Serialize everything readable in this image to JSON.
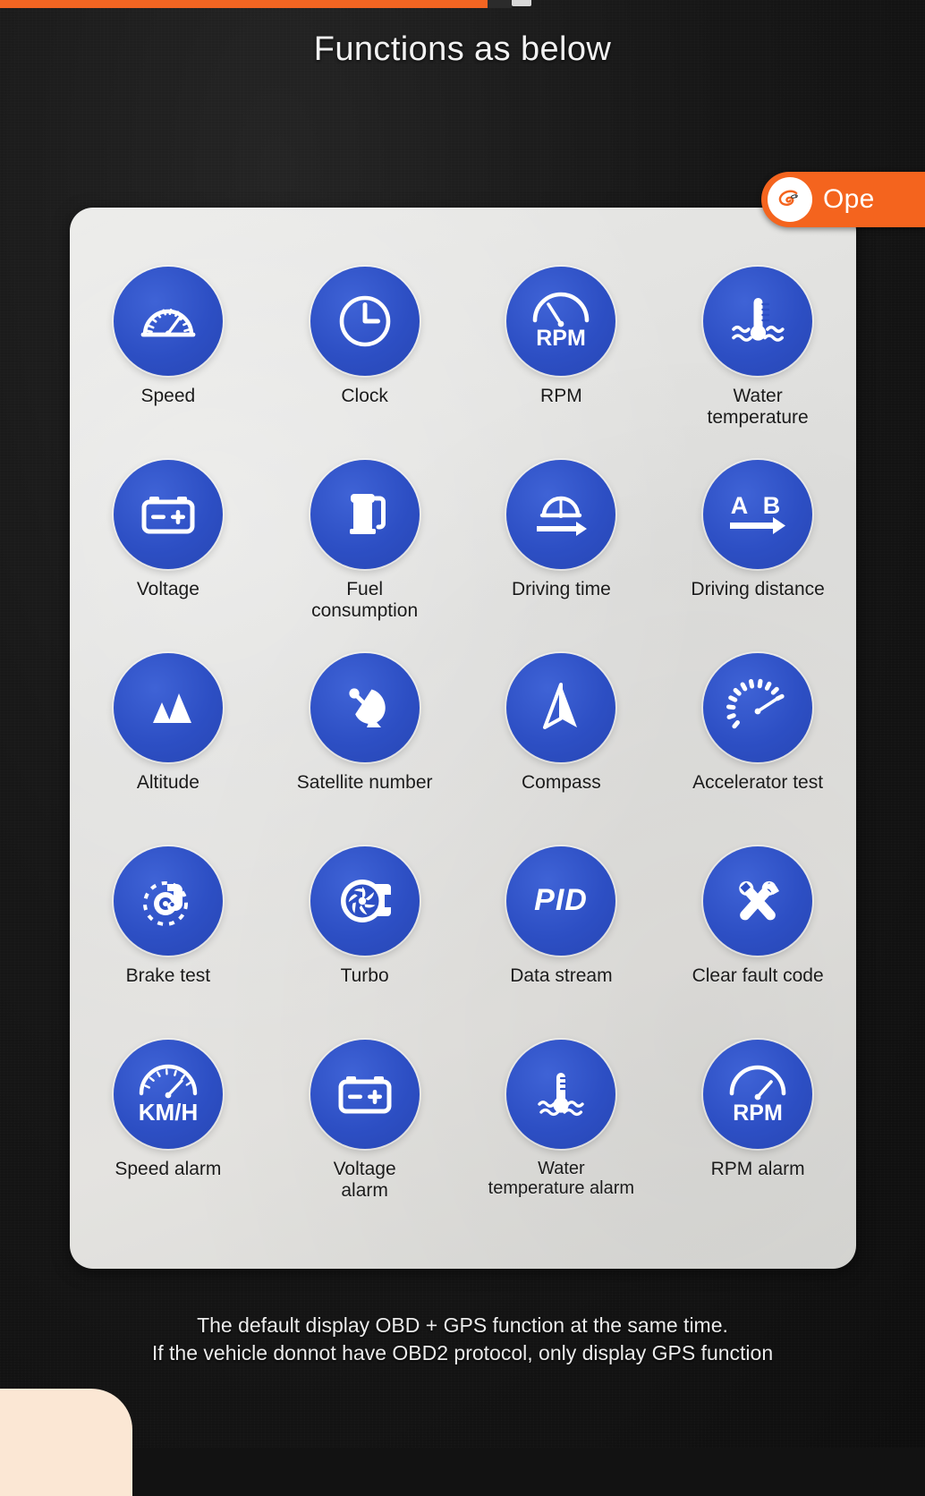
{
  "heading": "Functions as below",
  "colors": {
    "accent_orange": "#f26522",
    "badge_orange": "#f4641e",
    "icon_blue": "#2d4fc4",
    "panel_bg": "#e2e2e0",
    "page_bg": "#121212",
    "note_text": "#ececec"
  },
  "badge": {
    "label": "Ope",
    "icon": "alibaba-logo-icon"
  },
  "top_strip": {
    "color": "#f26522"
  },
  "features": [
    {
      "label": "Speed",
      "icon": "speedometer-gauge-icon"
    },
    {
      "label": "Clock",
      "icon": "clock-icon"
    },
    {
      "label": "RPM",
      "icon": "rpm-gauge-icon",
      "text": "RPM"
    },
    {
      "label": "Water\ntemperature",
      "icon": "water-temperature-icon"
    },
    {
      "label": "Voltage",
      "icon": "battery-icon"
    },
    {
      "label": "Fuel\nconsumption",
      "icon": "fuel-pump-icon"
    },
    {
      "label": "Driving time",
      "icon": "driving-time-icon"
    },
    {
      "label": "Driving distance",
      "icon": "driving-distance-icon",
      "text": "A B"
    },
    {
      "label": "Altitude",
      "icon": "mountains-icon"
    },
    {
      "label": "Satellite number",
      "icon": "satellite-dish-icon"
    },
    {
      "label": "Compass",
      "icon": "compass-needle-icon"
    },
    {
      "label": "Accelerator test",
      "icon": "accelerator-gauge-icon"
    },
    {
      "label": "Brake test",
      "icon": "brake-disc-icon"
    },
    {
      "label": "Turbo",
      "icon": "turbocharger-icon"
    },
    {
      "label": "Data stream",
      "icon": "pid-text-icon",
      "text": "PID"
    },
    {
      "label": "Clear fault code",
      "icon": "crossed-wrenches-icon"
    },
    {
      "label": "Speed alarm",
      "icon": "kmh-gauge-icon",
      "text": "KM/H"
    },
    {
      "label": "Voltage\nalarm",
      "icon": "battery-icon"
    },
    {
      "label": "Water\ntemperature alarm",
      "icon": "water-temperature-icon"
    },
    {
      "label": "RPM alarm",
      "icon": "rpm-gauge-icon",
      "text": "RPM"
    }
  ],
  "note": {
    "line1": "The default display OBD + GPS function at the same time.",
    "line2": "If the vehicle donnot have OBD2 protocol, only display GPS function"
  }
}
